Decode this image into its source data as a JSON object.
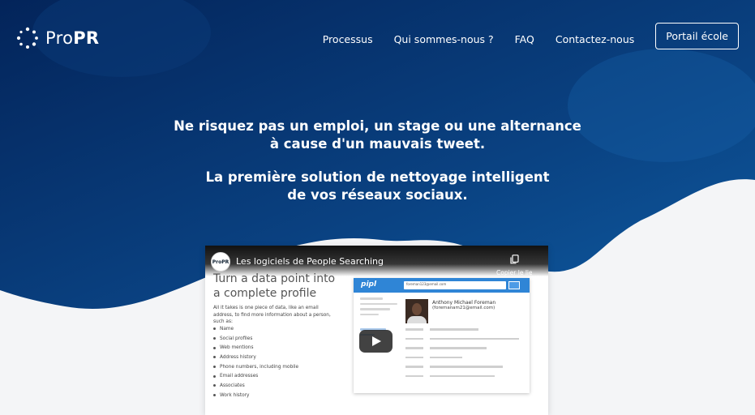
{
  "brand": {
    "name_light": "Pro",
    "name_bold": "PR"
  },
  "nav": {
    "links": [
      "Processus",
      "Qui sommes-nous ?",
      "FAQ",
      "Contactez-nous"
    ],
    "cta": "Portail école"
  },
  "hero": {
    "line1": "Ne risquez pas un emploi, un stage ou une alternance",
    "line2": "à cause d'un mauvais tweet.",
    "line3": "La première solution de nettoyage intelligent",
    "line4": "de vos réseaux sociaux."
  },
  "video": {
    "channel_avatar": "ProPR",
    "title": "Les logiciels de People Searching",
    "copy_label": "Copier le lien",
    "slide": {
      "title_line1": "Turn a data point into",
      "title_line2": "a complete profile",
      "intro": "All it takes is one piece of data, like an email address, to find more information about a person, such as:",
      "items": [
        "Name",
        "Social profiles",
        "Web mentions",
        "Address history",
        "Phone numbers, including mobile",
        "Email addresses",
        "Associates",
        "Work history"
      ]
    },
    "pipl": {
      "logo": "pipl",
      "search": "foreman123@email.com",
      "name_line1": "Anthony Michael Foreman",
      "name_line2": "(foremanam21@email.com)"
    }
  },
  "colors": {
    "hero_dark": "#05275d",
    "hero_mid": "#0c4f94",
    "accent": "#2f85d6"
  }
}
